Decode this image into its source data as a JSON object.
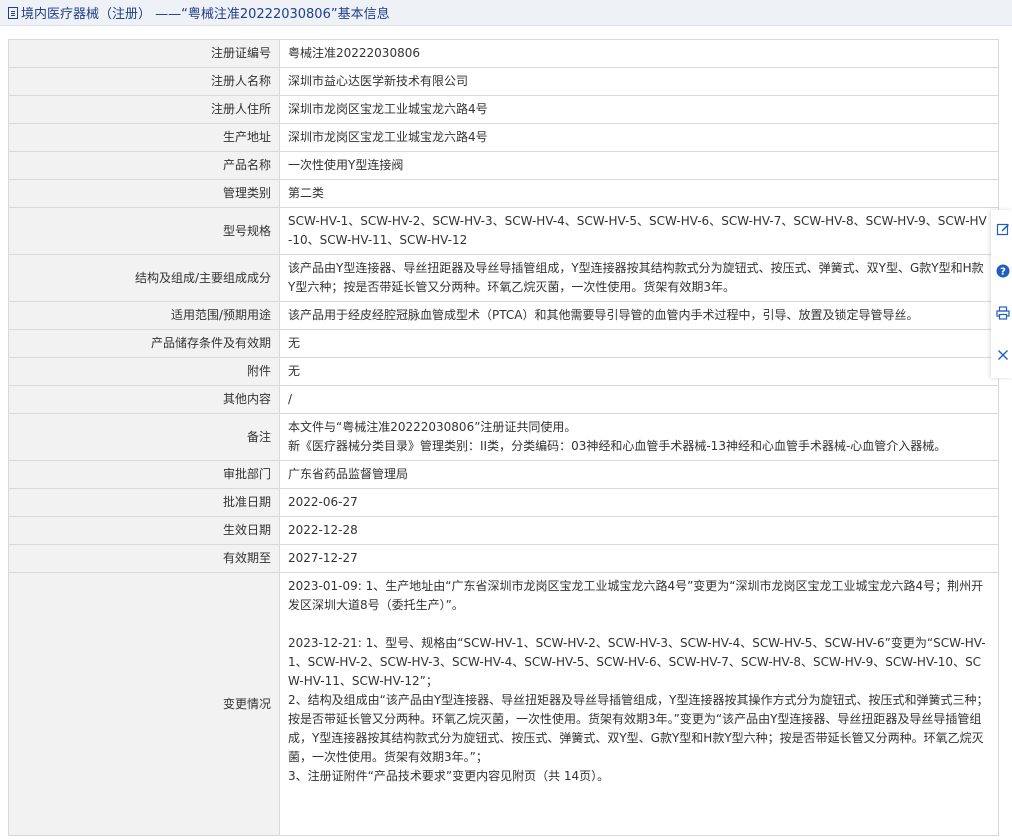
{
  "header": {
    "title": "境内医疗器械（注册） ——“粤械注准20222030806”基本信息"
  },
  "rows": [
    {
      "label": "注册证编号",
      "value": "粤械注准20222030806"
    },
    {
      "label": "注册人名称",
      "value": "深圳市益心达医学新技术有限公司"
    },
    {
      "label": "注册人住所",
      "value": "深圳市龙岗区宝龙工业城宝龙六路4号"
    },
    {
      "label": "生产地址",
      "value": "深圳市龙岗区宝龙工业城宝龙六路4号"
    },
    {
      "label": "产品名称",
      "value": "一次性使用Y型连接阀"
    },
    {
      "label": "管理类别",
      "value": "第二类"
    },
    {
      "label": "型号规格",
      "value": "SCW-HV-1、SCW-HV-2、SCW-HV-3、SCW-HV-4、SCW-HV-5、SCW-HV-6、SCW-HV-7、SCW-HV-8、SCW-HV-9、SCW-HV-10、SCW-HV-11、SCW-HV-12"
    },
    {
      "label": "结构及组成/主要组成成分",
      "value": "该产品由Y型连接器、导丝扭距器及导丝导插管组成，Y型连接器按其结构款式分为旋钮式、按压式、弹簧式、双Y型、G款Y型和H款Y型六种；按是否带延长管又分两种。环氧乙烷灭菌，一次性使用。货架有效期3年。"
    },
    {
      "label": "适用范围/预期用途",
      "value": "该产品用于经皮经腔冠脉血管成型术（PTCA）和其他需要导引导管的血管内手术过程中，引导、放置及锁定导管导丝。"
    },
    {
      "label": "产品储存条件及有效期",
      "value": "无"
    },
    {
      "label": "附件",
      "value": "无"
    },
    {
      "label": "其他内容",
      "value": "/"
    },
    {
      "label": "备注",
      "line1": "本文件与“粤械注准20222030806”注册证共同使用。",
      "line2": "新《医疗器械分类目录》管理类别：II类，分类编码：03神经和心血管手术器械-13神经和心血管手术器械-心血管介入器械。"
    },
    {
      "label": "审批部门",
      "value": "广东省药品监督管理局"
    },
    {
      "label": "批准日期",
      "value": "2022-06-27"
    },
    {
      "label": "生效日期",
      "value": "2022-12-28"
    },
    {
      "label": "有效期至",
      "value": "2027-12-27"
    },
    {
      "label": "变更情况",
      "p1": "2023-01-09: 1、生产地址由“广东省深圳市龙岗区宝龙工业城宝龙六路4号”变更为“深圳市龙岗区宝龙工业城宝龙六路4号；荆州开发区深圳大道8号（委托生产）”。",
      "p2": "2023-12-21: 1、型号、规格由“SCW-HV-1、SCW-HV-2、SCW-HV-3、SCW-HV-4、SCW-HV-5、SCW-HV-6”变更为“SCW-HV-1、SCW-HV-2、SCW-HV-3、SCW-HV-4、SCW-HV-5、SCW-HV-6、SCW-HV-7、SCW-HV-8、SCW-HV-9、SCW-HV-10、SCW-HV-11、SCW-HV-12”；",
      "p3": "2、结构及组成由“该产品由Y型连接器、导丝扭矩器及导丝导插管组成，Y型连接器按其操作方式分为旋钮式、按压式和弹簧式三种；按是否带延长管又分两种。环氧乙烷灭菌，一次性使用。货架有效期3年。”变更为“该产品由Y型连接器、导丝扭距器及导丝导插管组成，Y型连接器按其结构款式分为旋钮式、按压式、弹簧式、双Y型、G款Y型和H款Y型六种；按是否带延长管又分两种。环氧乙烷灭菌，一次性使用。货架有效期3年。”；",
      "p4": "3、注册证附件“产品技术要求”变更内容见附页（共 14页）。"
    }
  ],
  "toolbar": {
    "icons": [
      "edit-icon",
      "help-icon",
      "print-icon",
      "close-icon"
    ],
    "accent": "#1f5fbf"
  }
}
